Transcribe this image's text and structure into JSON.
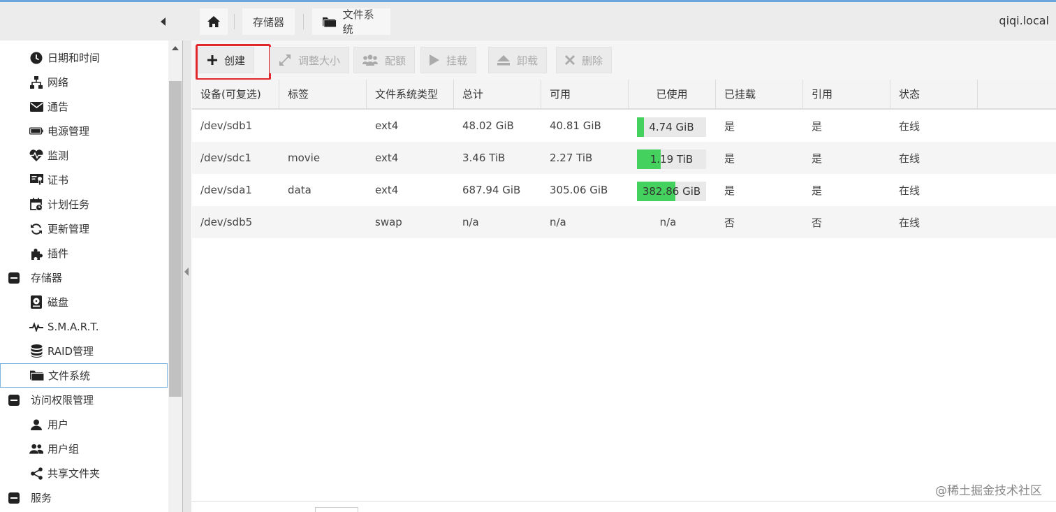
{
  "header": {
    "breadcrumb": [
      {
        "label": "存储器"
      },
      {
        "label": "文件系统"
      }
    ],
    "hostname": "qiqi.local"
  },
  "sidebar": {
    "items": [
      {
        "label": "日期和时间",
        "icon": "clock-icon"
      },
      {
        "label": "网络",
        "icon": "network-icon"
      },
      {
        "label": "通告",
        "icon": "envelope-icon"
      },
      {
        "label": "电源管理",
        "icon": "battery-icon"
      },
      {
        "label": "监测",
        "icon": "heartbeat-icon"
      },
      {
        "label": "证书",
        "icon": "certificate-icon"
      },
      {
        "label": "计划任务",
        "icon": "calendar-icon"
      },
      {
        "label": "更新管理",
        "icon": "refresh-icon"
      },
      {
        "label": "插件",
        "icon": "puzzle-icon"
      },
      {
        "label": "存储器",
        "icon": "collapse-icon"
      },
      {
        "label": "磁盘",
        "icon": "harddisk-icon"
      },
      {
        "label": "S.M.A.R.T.",
        "icon": "pulse-icon"
      },
      {
        "label": "RAID管理",
        "icon": "database-icon"
      },
      {
        "label": "文件系统",
        "icon": "folder-icon"
      },
      {
        "label": "访问权限管理",
        "icon": "collapse-icon"
      },
      {
        "label": "用户",
        "icon": "user-icon"
      },
      {
        "label": "用户组",
        "icon": "users-icon"
      },
      {
        "label": "共享文件夹",
        "icon": "share-icon"
      },
      {
        "label": "服务",
        "icon": "collapse-icon"
      }
    ]
  },
  "toolbar": {
    "create": "创建",
    "resize": "调整大小",
    "quota": "配额",
    "mount": "挂载",
    "unmount": "卸载",
    "delete": "删除"
  },
  "table": {
    "headers": [
      "设备(可复选)",
      "标签",
      "文件系统类型",
      "总计",
      "可用",
      "已使用",
      "已挂载",
      "引用",
      "状态"
    ],
    "rows": [
      {
        "device": "/dev/sdb1",
        "label": "",
        "type": "ext4",
        "total": "48.02 GiB",
        "available": "40.81 GiB",
        "used": "4.74 GiB",
        "used_fraction": 0.1,
        "mounted": "是",
        "referenced": "是",
        "status": "在线"
      },
      {
        "device": "/dev/sdc1",
        "label": "movie",
        "type": "ext4",
        "total": "3.46 TiB",
        "available": "2.27 TiB",
        "used": "1.19 TiB",
        "used_fraction": 0.34,
        "mounted": "是",
        "referenced": "是",
        "status": "在线"
      },
      {
        "device": "/dev/sda1",
        "label": "data",
        "type": "ext4",
        "total": "687.94 GiB",
        "available": "305.06 GiB",
        "used": "382.86 GiB",
        "used_fraction": 0.56,
        "mounted": "是",
        "referenced": "是",
        "status": "在线"
      },
      {
        "device": "/dev/sdb5",
        "label": "",
        "type": "swap",
        "total": "n/a",
        "available": "n/a",
        "used": "n/a",
        "used_fraction": null,
        "mounted": "否",
        "referenced": "否",
        "status": "在线"
      }
    ]
  },
  "watermark": "@稀土掘金技术社区",
  "colors": {
    "usage_fill": "#44d15e",
    "highlight": "#e0262a",
    "accent": "#6aa6dc"
  }
}
